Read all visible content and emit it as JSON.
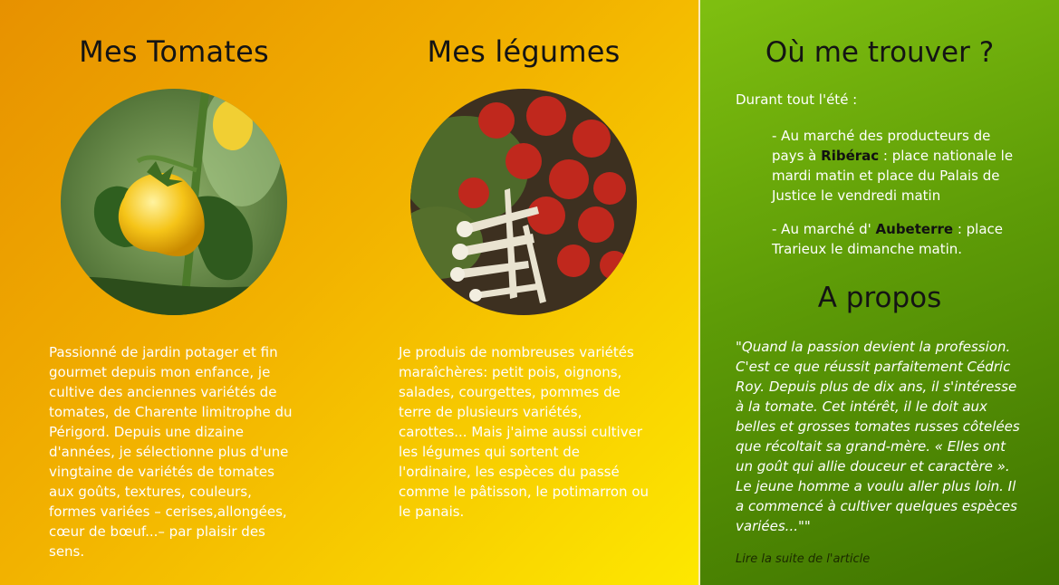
{
  "tomatoes": {
    "title": "Mes Tomates",
    "text": "Passionné de jardin potager et fin gourmet depuis mon enfance, je cultive des anciennes variétés de tomates, de Charente limitrophe du Périgord. Depuis une dizaine d'années, je sélectionne plus d'une vingtaine de variétés de tomates aux goûts, textures, couleurs, formes variées – cerises,allongées, cœur de bœuf...– par plaisir des sens."
  },
  "vegetables": {
    "title": "Mes légumes",
    "text": "Je produis de nombreuses variétés maraîchères: petit pois, oignons, salades, courgettes, pommes de terre de plusieurs variétés, carottes... Mais j'aime aussi cultiver les légumes qui sortent de l'ordinaire, les espèces du passé comme le pâtisson, le potimarron ou le panais."
  },
  "location": {
    "title": "Où me trouver ?",
    "intro": "Durant tout l'été :",
    "entries": [
      {
        "prefix": "- Au marché des producteurs de pays à ",
        "place": "Ribérac",
        "suffix": " : place nationale le mardi matin et place du Palais de Justice le vendredi matin"
      },
      {
        "prefix": "- Au marché d' ",
        "place": "Aubeterre",
        "suffix": " : place Trarieux le dimanche matin."
      }
    ]
  },
  "about": {
    "title": "A propos",
    "quote": "\"Quand la passion devient la profession. C'est ce que réussit parfaitement Cédric Roy. Depuis plus de dix ans, il s'intéresse à la tomate. Cet intérêt, il le doit aux belles et grosses tomates russes côtelées que récoltait sa grand-mère. « Elles ont un goût qui allie douceur et caractère ». Le jeune homme a voulu aller plus loin. Il a commencé à cultiver quelques espèces variées...\"\"",
    "link": "Lire la suite de l'article"
  },
  "colors": {
    "left_gradient": [
      "#e79100",
      "#fde800"
    ],
    "right_gradient": [
      "#7fbf10",
      "#3f7400"
    ]
  }
}
